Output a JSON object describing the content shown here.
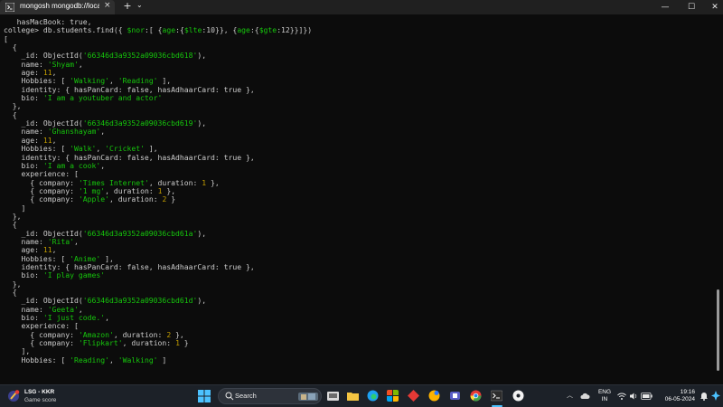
{
  "window": {
    "tab_title": "mongosh mongodb://localho",
    "tab_close": "×",
    "new_tab": "+",
    "dropdown": "⌄",
    "minimize": "—",
    "maximize": "☐",
    "close": "✕"
  },
  "terminal": {
    "lines": [
      [
        {
          "t": "   hasMacBook: true,"
        }
      ],
      [
        {
          "t": "college> db.students.find({ "
        },
        {
          "t": "$nor",
          "c": "s"
        },
        {
          "t": ":[ {"
        },
        {
          "t": "age",
          "c": "s"
        },
        {
          "t": ":{"
        },
        {
          "t": "$lte",
          "c": "s"
        },
        {
          "t": ":10}}, {"
        },
        {
          "t": "age",
          "c": "s"
        },
        {
          "t": ":{"
        },
        {
          "t": "$gte",
          "c": "s"
        },
        {
          "t": ":12}}]})"
        }
      ],
      [
        {
          "t": "["
        }
      ],
      [
        {
          "t": "  {"
        }
      ],
      [
        {
          "t": "    _id: ObjectId("
        },
        {
          "t": "'66346d3a9352a09036cbd618'",
          "c": "s"
        },
        {
          "t": "),"
        }
      ],
      [
        {
          "t": "    name: "
        },
        {
          "t": "'Shyam'",
          "c": "s"
        },
        {
          "t": ","
        }
      ],
      [
        {
          "t": "    age: "
        },
        {
          "t": "11",
          "c": "n"
        },
        {
          "t": ","
        }
      ],
      [
        {
          "t": "    Hobbies: [ "
        },
        {
          "t": "'Walking'",
          "c": "s"
        },
        {
          "t": ", "
        },
        {
          "t": "'Reading'",
          "c": "s"
        },
        {
          "t": " ],"
        }
      ],
      [
        {
          "t": "    identity: { hasPanCard: false, hasAdhaarCard: true },"
        }
      ],
      [
        {
          "t": "    bio: "
        },
        {
          "t": "'I am a youtuber and actor'",
          "c": "s"
        }
      ],
      [
        {
          "t": "  },"
        }
      ],
      [
        {
          "t": "  {"
        }
      ],
      [
        {
          "t": "    _id: ObjectId("
        },
        {
          "t": "'66346d3a9352a09036cbd619'",
          "c": "s"
        },
        {
          "t": "),"
        }
      ],
      [
        {
          "t": "    name: "
        },
        {
          "t": "'Ghanshayam'",
          "c": "s"
        },
        {
          "t": ","
        }
      ],
      [
        {
          "t": "    age: "
        },
        {
          "t": "11",
          "c": "n"
        },
        {
          "t": ","
        }
      ],
      [
        {
          "t": "    Hobbies: [ "
        },
        {
          "t": "'Walk'",
          "c": "s"
        },
        {
          "t": ", "
        },
        {
          "t": "'Cricket'",
          "c": "s"
        },
        {
          "t": " ],"
        }
      ],
      [
        {
          "t": "    identity: { hasPanCard: false, hasAdhaarCard: true },"
        }
      ],
      [
        {
          "t": "    bio: "
        },
        {
          "t": "'I am a cook'",
          "c": "s"
        },
        {
          "t": ","
        }
      ],
      [
        {
          "t": "    experience: ["
        }
      ],
      [
        {
          "t": "      { company: "
        },
        {
          "t": "'Times Internet'",
          "c": "s"
        },
        {
          "t": ", duration: "
        },
        {
          "t": "1",
          "c": "n"
        },
        {
          "t": " },"
        }
      ],
      [
        {
          "t": "      { company: "
        },
        {
          "t": "'1 mg'",
          "c": "s"
        },
        {
          "t": ", duration: "
        },
        {
          "t": "1",
          "c": "n"
        },
        {
          "t": " },"
        }
      ],
      [
        {
          "t": "      { company: "
        },
        {
          "t": "'Apple'",
          "c": "s"
        },
        {
          "t": ", duration: "
        },
        {
          "t": "2",
          "c": "n"
        },
        {
          "t": " }"
        }
      ],
      [
        {
          "t": "    ]"
        }
      ],
      [
        {
          "t": "  },"
        }
      ],
      [
        {
          "t": "  {"
        }
      ],
      [
        {
          "t": "    _id: ObjectId("
        },
        {
          "t": "'66346d3a9352a09036cbd61a'",
          "c": "s"
        },
        {
          "t": "),"
        }
      ],
      [
        {
          "t": "    name: "
        },
        {
          "t": "'Rita'",
          "c": "s"
        },
        {
          "t": ","
        }
      ],
      [
        {
          "t": "    age: "
        },
        {
          "t": "11",
          "c": "n"
        },
        {
          "t": ","
        }
      ],
      [
        {
          "t": "    Hobbies: [ "
        },
        {
          "t": "'Anime'",
          "c": "s"
        },
        {
          "t": " ],"
        }
      ],
      [
        {
          "t": "    identity: { hasPanCard: false, hasAdhaarCard: true },"
        }
      ],
      [
        {
          "t": "    bio: "
        },
        {
          "t": "'I play games'",
          "c": "s"
        }
      ],
      [
        {
          "t": "  },"
        }
      ],
      [
        {
          "t": "  {"
        }
      ],
      [
        {
          "t": "    _id: ObjectId("
        },
        {
          "t": "'66346d3a9352a09036cbd61d'",
          "c": "s"
        },
        {
          "t": "),"
        }
      ],
      [
        {
          "t": "    name: "
        },
        {
          "t": "'Geeta'",
          "c": "s"
        },
        {
          "t": ","
        }
      ],
      [
        {
          "t": "    bio: "
        },
        {
          "t": "'I just code.'",
          "c": "s"
        },
        {
          "t": ","
        }
      ],
      [
        {
          "t": "    experience: ["
        }
      ],
      [
        {
          "t": "      { company: "
        },
        {
          "t": "'Amazon'",
          "c": "s"
        },
        {
          "t": ", duration: "
        },
        {
          "t": "2",
          "c": "n"
        },
        {
          "t": " },"
        }
      ],
      [
        {
          "t": "      { company: "
        },
        {
          "t": "'Flipkart'",
          "c": "s"
        },
        {
          "t": ", duration: "
        },
        {
          "t": "1",
          "c": "n"
        },
        {
          "t": " }"
        }
      ],
      [
        {
          "t": "    ],"
        }
      ],
      [
        {
          "t": "    Hobbies: [ "
        },
        {
          "t": "'Reading'",
          "c": "s"
        },
        {
          "t": ", "
        },
        {
          "t": "'Walking'",
          "c": "s"
        },
        {
          "t": " ]"
        }
      ]
    ]
  },
  "taskbar": {
    "weather_title": "LSG - KKR",
    "weather_sub": "Game score",
    "search_placeholder": "Search",
    "lang_top": "ENG",
    "lang_bottom": "IN",
    "time": "19:16",
    "date": "06-05-2024",
    "apps": [
      "file-explorer-icon",
      "folder-icon",
      "edge-icon",
      "store-icon",
      "app-icon",
      "chrome-icon",
      "teams-icon",
      "vscode-icon",
      "terminal-icon",
      "app-icon"
    ]
  },
  "colors": {
    "background": "#0c0c0c",
    "string": "#16c60c",
    "number": "#c19c00",
    "text": "#cccccc",
    "accent": "#4cc2ff"
  }
}
